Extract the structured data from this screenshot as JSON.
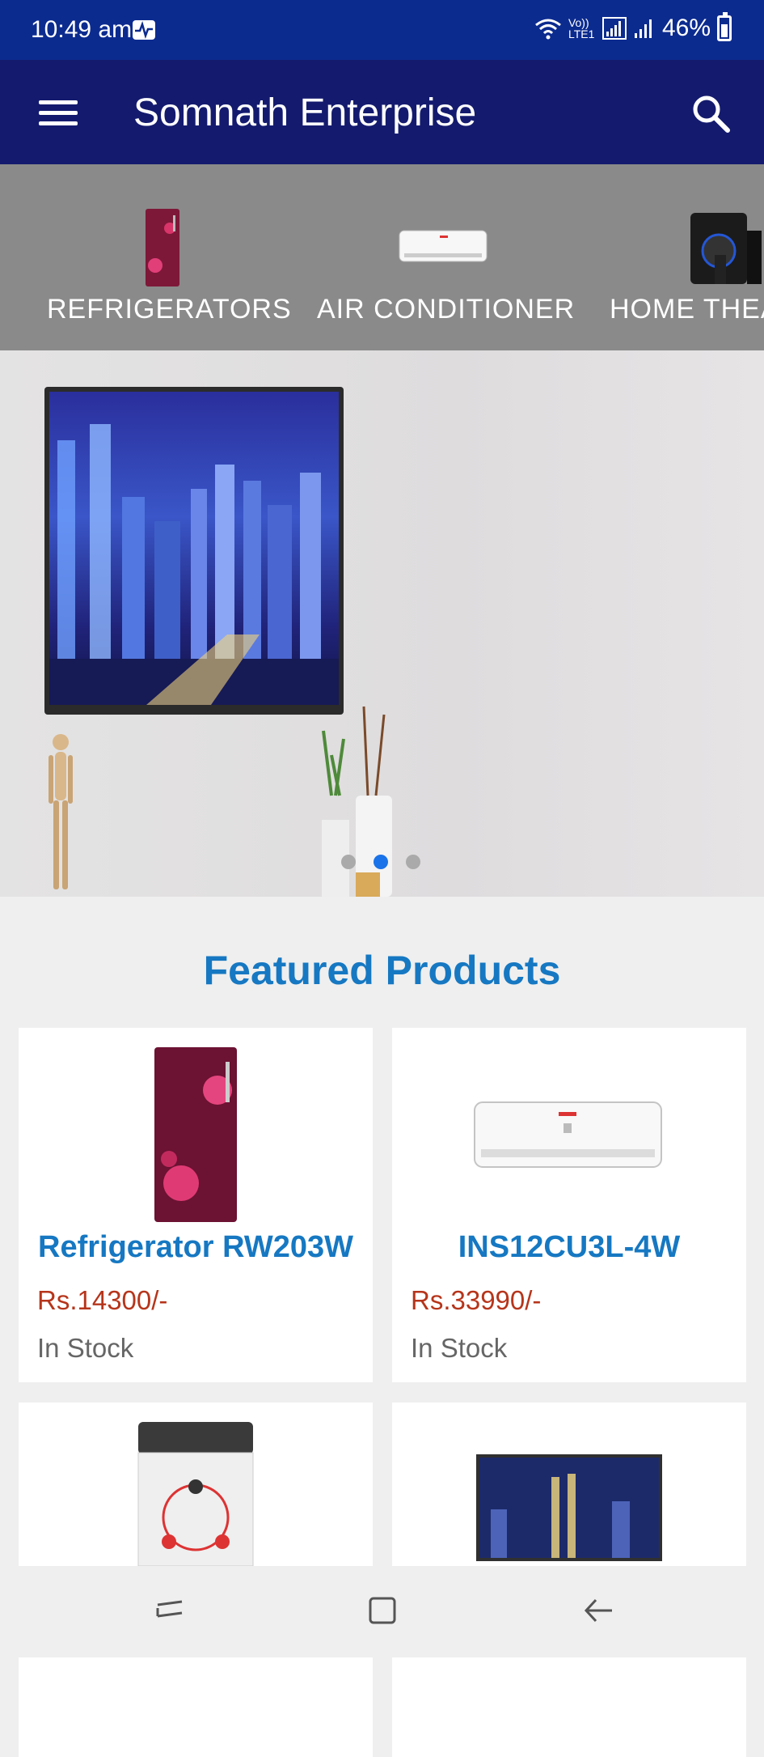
{
  "status_bar": {
    "time": "10:49 am",
    "network": "Vo)) LTE1",
    "battery": "46%"
  },
  "app_bar": {
    "title": "Somnath Enterprise",
    "menu_icon": "hamburger-menu-icon",
    "search_icon": "search-icon"
  },
  "categories": [
    {
      "label": "REFRIGERATORS",
      "icon": "refrigerator-image"
    },
    {
      "label": "AIR CONDITIONER",
      "icon": "air-conditioner-image"
    },
    {
      "label": "HOME THEA",
      "icon": "home-theater-image"
    }
  ],
  "banner": {
    "slide_count": 3,
    "active_slide": 2
  },
  "featured": {
    "title": "Featured Products",
    "products": [
      {
        "name": "Refrigerator RW203W",
        "price": "Rs.14300/-",
        "stock": "In Stock"
      },
      {
        "name": "INS12CU3L-4W",
        "price": "Rs.33990/-",
        "stock": "In Stock"
      },
      {
        "name": "",
        "price": "",
        "stock": ""
      },
      {
        "name": "",
        "price": "",
        "stock": ""
      }
    ]
  },
  "colors": {
    "status_bar": "#0c2b8f",
    "app_bar": "#141b6e",
    "accent": "#1678c2",
    "price": "#b6351b"
  }
}
